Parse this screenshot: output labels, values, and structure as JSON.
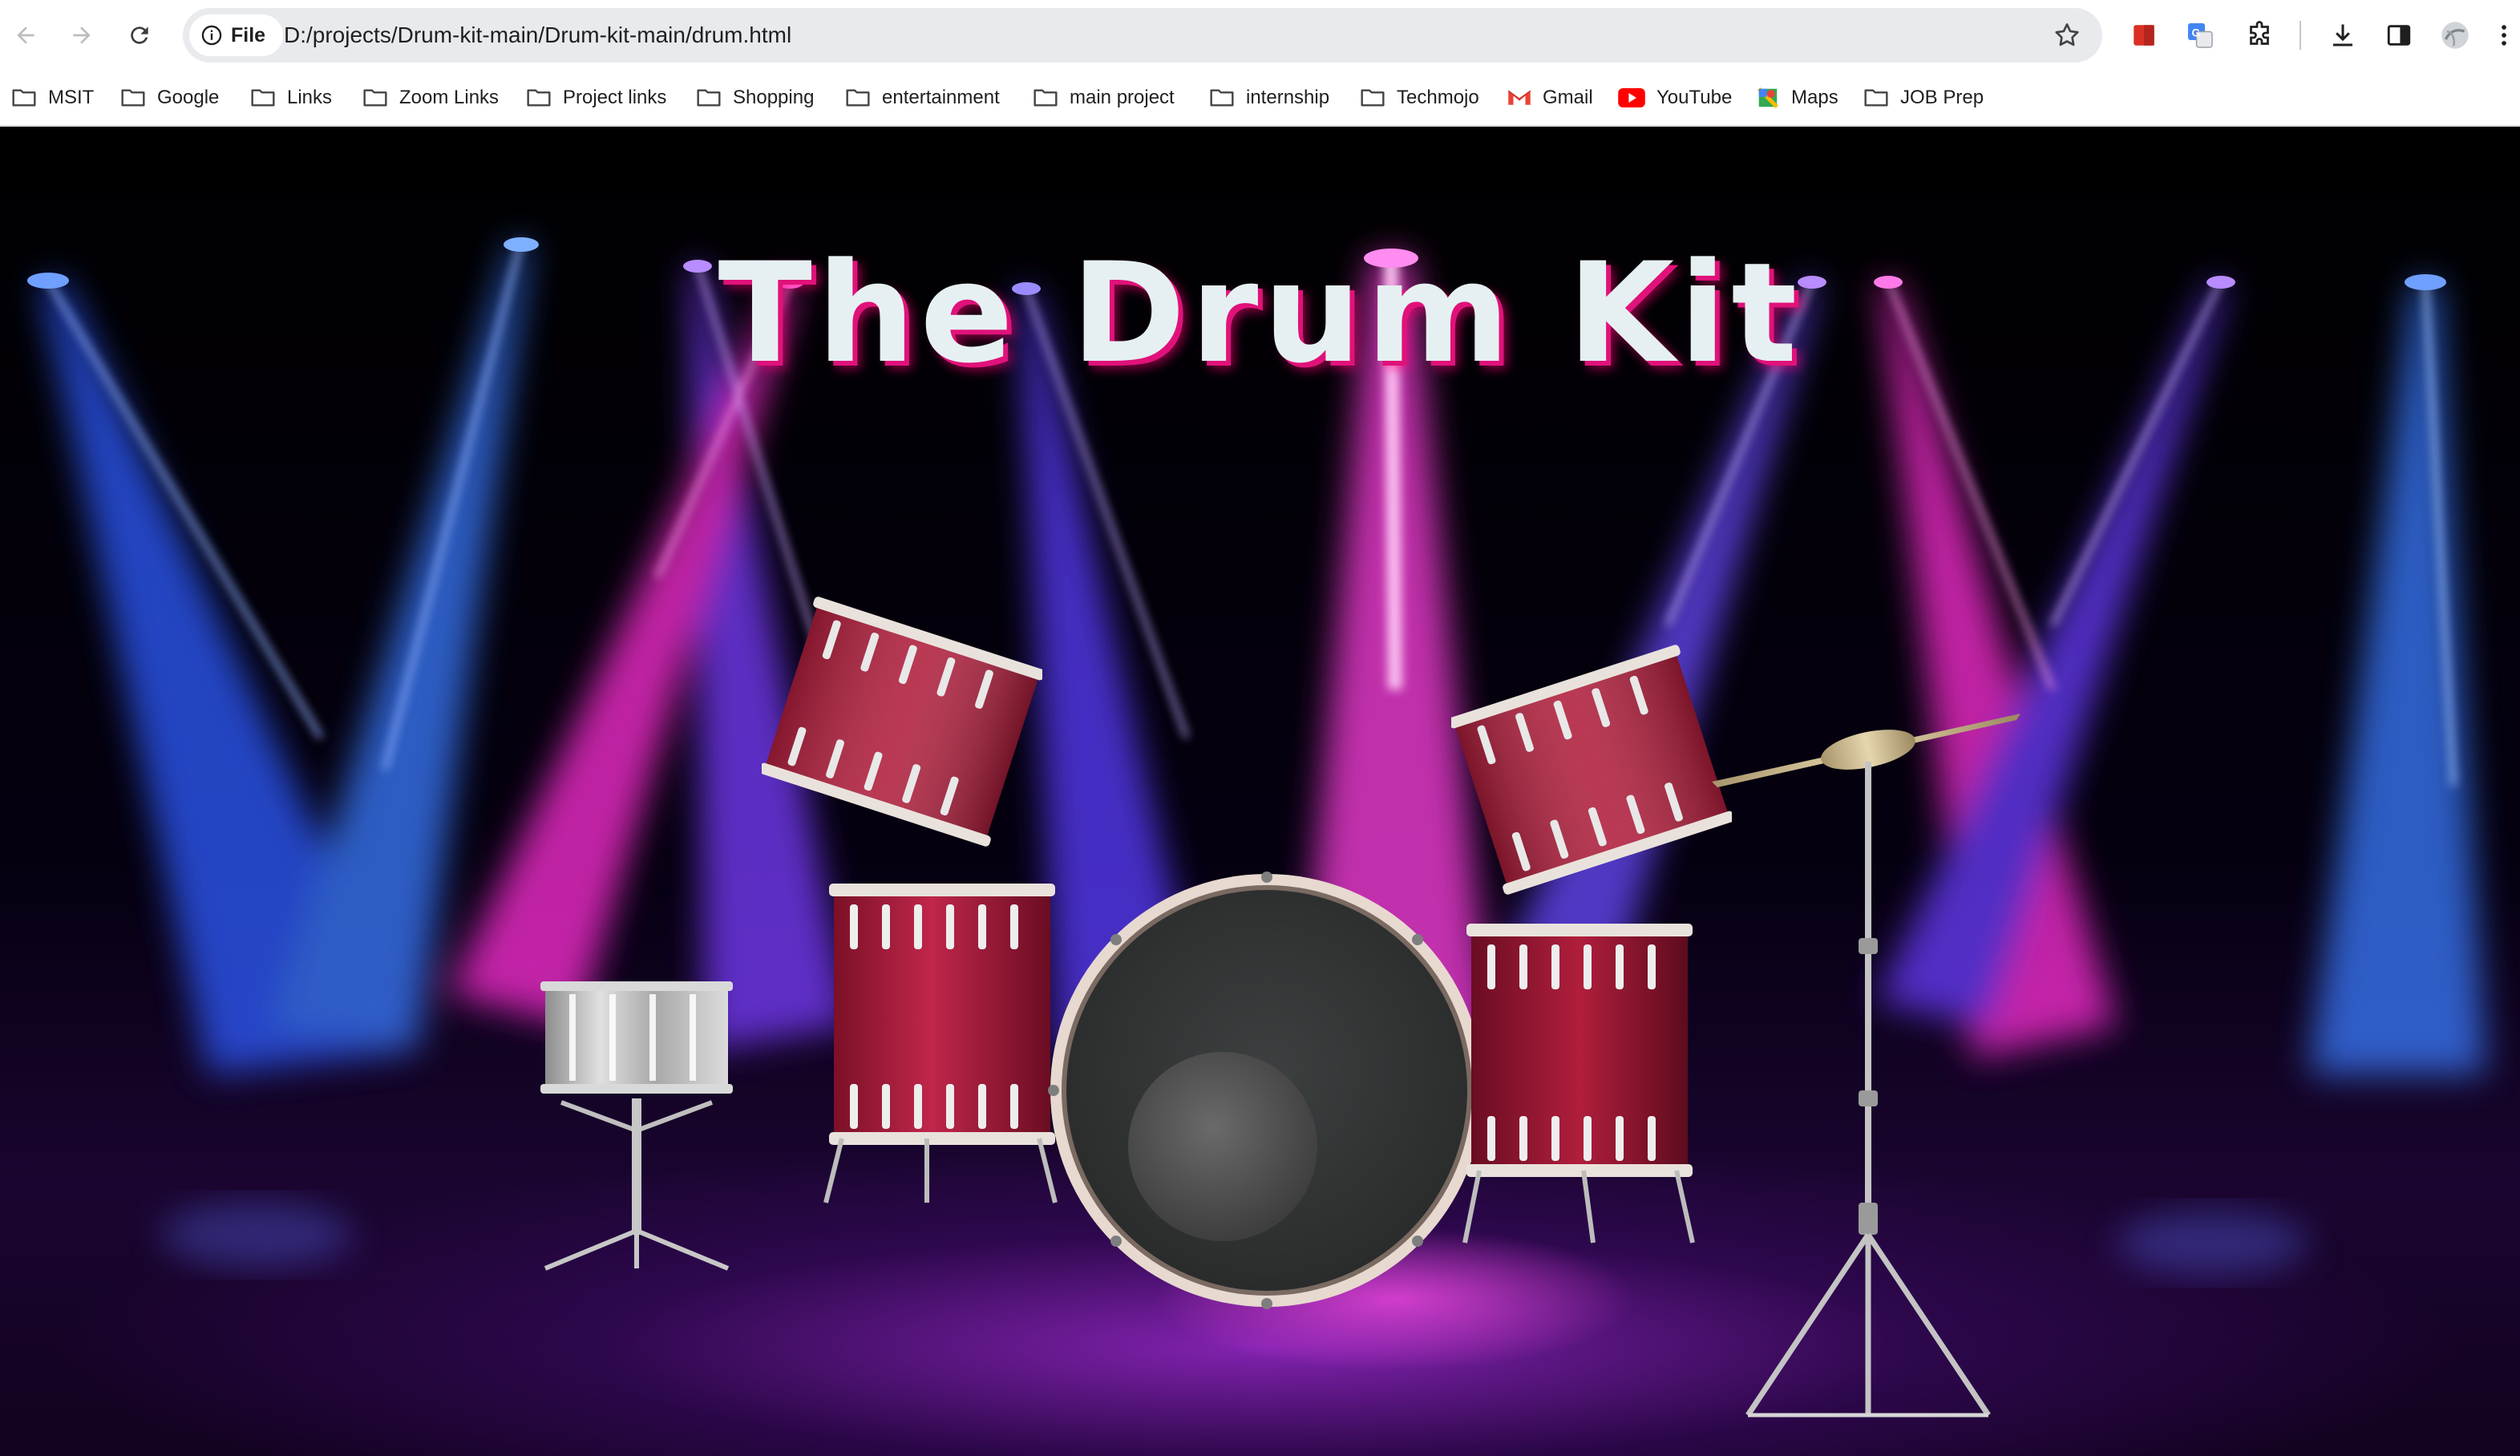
{
  "browser": {
    "file_chip_label": "File",
    "url": "D:/projects/Drum-kit-main/Drum-kit-main/drum.html"
  },
  "bookmarks": [
    {
      "label": "MSIT",
      "icon": "folder-icon"
    },
    {
      "label": "Google",
      "icon": "folder-icon"
    },
    {
      "label": "Links",
      "icon": "folder-icon"
    },
    {
      "label": "Zoom Links",
      "icon": "folder-icon"
    },
    {
      "label": "Project links",
      "icon": "folder-icon"
    },
    {
      "label": "Shopping",
      "icon": "folder-icon"
    },
    {
      "label": "entertainment",
      "icon": "folder-icon"
    },
    {
      "label": "main project",
      "icon": "folder-icon"
    },
    {
      "label": "internship",
      "icon": "folder-icon"
    },
    {
      "label": "Techmojo",
      "icon": "folder-icon"
    },
    {
      "label": "Gmail",
      "icon": "gmail-icon"
    },
    {
      "label": "YouTube",
      "icon": "youtube-icon"
    },
    {
      "label": "Maps",
      "icon": "maps-icon"
    },
    {
      "label": "JOB Prep",
      "icon": "folder-icon"
    }
  ],
  "page": {
    "title": "The Drum Kit"
  },
  "colors": {
    "drum_red": "#b01e3c",
    "title_shadow": "#e0127a",
    "beam_blue": "#3c6cff",
    "beam_pink": "#ff2fd6"
  }
}
